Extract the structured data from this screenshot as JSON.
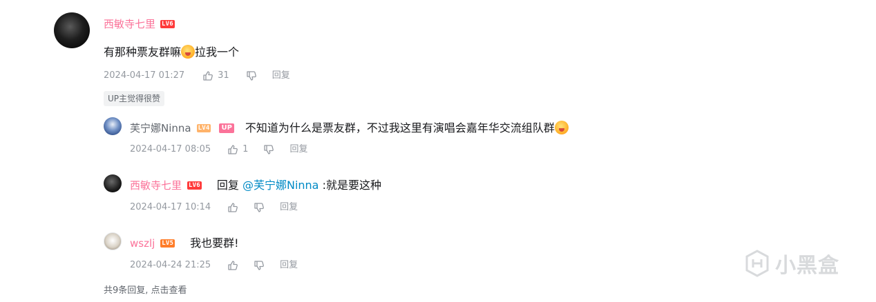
{
  "main_comment": {
    "username": "西敏寺七里",
    "level": "LV6",
    "content_before": "有那种票友群嘛",
    "emoji": "emoji-shocked",
    "content_after": "拉我一个",
    "date": "2024-04-17 01:27",
    "likes": "31",
    "reply_label": "回复",
    "up_liked": "UP主觉得很赞"
  },
  "replies": [
    {
      "username": "芙宁娜Ninna",
      "level": "LV4",
      "badge": "UP",
      "content": "不知道为什么是票友群，不过我这里有演唱会嘉年华交流组队群",
      "date": "2024-04-17 08:05",
      "likes": "1",
      "reply_label": "回复"
    },
    {
      "username": "西敏寺七里",
      "level": "LV6",
      "reply_prefix": "回复 ",
      "mention": "@芙宁娜Ninna",
      "content": " :就是要这种",
      "date": "2024-04-17 10:14",
      "reply_label": "回复"
    },
    {
      "username": "wszlj",
      "level": "LV5",
      "content": "我也要群!",
      "date": "2024-04-24 21:25",
      "reply_label": "回复"
    }
  ],
  "more_replies": "共9条回复, 点击查看",
  "watermark": "小黑盒",
  "colors": {
    "pink": "#fb7299",
    "meta": "#9499a0",
    "mention": "#008ac5"
  }
}
